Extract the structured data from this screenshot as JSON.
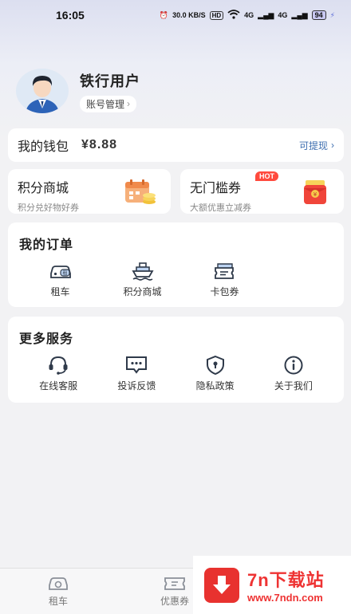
{
  "status_bar": {
    "time": "16:05",
    "speed": "30.0 KB/S",
    "hd": "HD",
    "signal1": "4G",
    "signal2": "4G",
    "battery": "94"
  },
  "profile": {
    "username": "铁行用户",
    "account_label": "账号管理"
  },
  "wallet": {
    "label": "我的钱包",
    "amount": "¥8.88",
    "withdraw_label": "可提现"
  },
  "promos": [
    {
      "title": "积分商城",
      "subtitle": "积分兑好物好券",
      "icon": "calendar-coins-icon"
    },
    {
      "title": "无门槛券",
      "subtitle": "大额优惠立减券",
      "icon": "red-envelope-icon",
      "badge": "HOT"
    }
  ],
  "orders": {
    "title": "我的订单",
    "items": [
      {
        "label": "租车",
        "icon": "car-rent-icon"
      },
      {
        "label": "积分商城",
        "icon": "ship-icon"
      },
      {
        "label": "卡包券",
        "icon": "ticket-icon"
      }
    ]
  },
  "services": {
    "title": "更多服务",
    "items": [
      {
        "label": "在线客服",
        "icon": "headset-icon"
      },
      {
        "label": "投诉反馈",
        "icon": "feedback-icon"
      },
      {
        "label": "隐私政策",
        "icon": "shield-lock-icon"
      },
      {
        "label": "关于我们",
        "icon": "info-icon"
      }
    ]
  },
  "tabbar": [
    {
      "label": "租车",
      "icon": "car-tab-icon"
    },
    {
      "label": "优惠券",
      "icon": "coupon-tab-icon"
    }
  ],
  "watermark": {
    "title": "7n下载站",
    "url": "www.7ndn.com"
  },
  "colors": {
    "accent_blue": "#3f6fb0",
    "icon_dark": "#2f3a4a",
    "hot_red": "#ff4a3d",
    "watermark_red": "#e33"
  }
}
